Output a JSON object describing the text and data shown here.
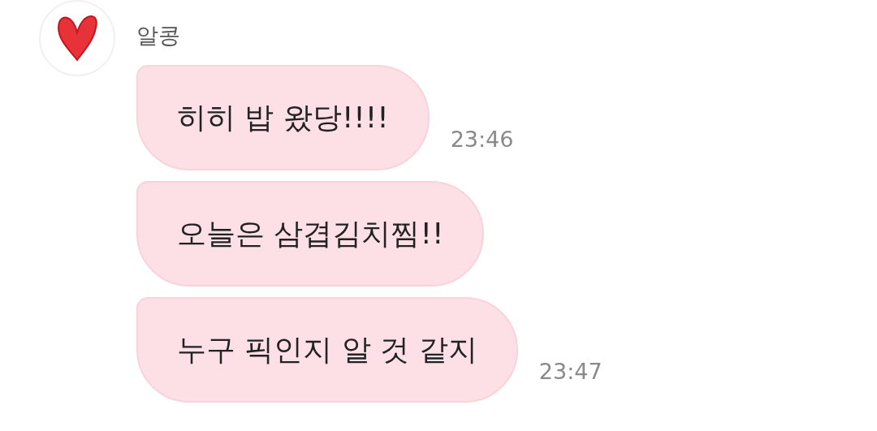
{
  "sender": {
    "name": "알콩"
  },
  "messages": [
    {
      "text": "히히 밥 왔당!!!!",
      "time": "23:46"
    },
    {
      "text": "오늘은 삼겹김치찜!!"
    },
    {
      "text": "누구 픽인지 알 것 같지",
      "time": "23:47"
    }
  ]
}
